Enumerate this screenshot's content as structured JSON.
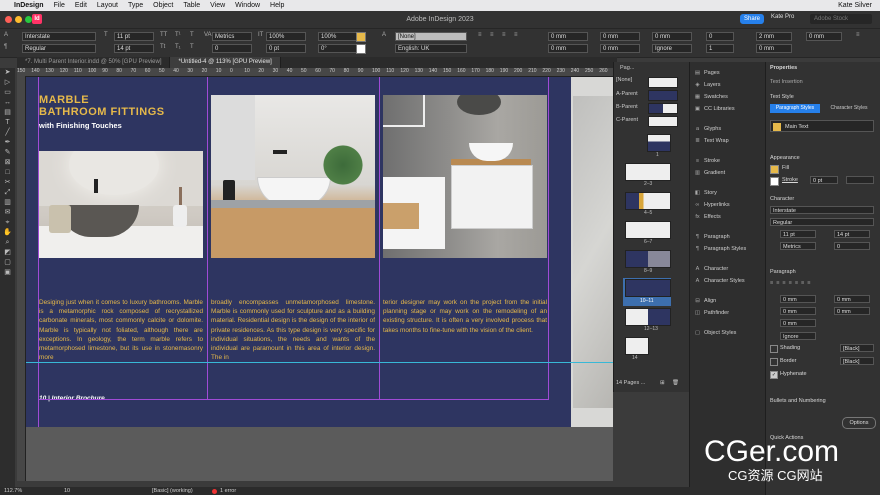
{
  "menubar": {
    "app": "InDesign",
    "items": [
      "File",
      "Edit",
      "Layout",
      "Type",
      "Object",
      "Table",
      "View",
      "Window",
      "Help"
    ],
    "user": "Kate Silver"
  },
  "titlebar": {
    "title": "Adobe InDesign 2023",
    "share": "Share",
    "user": "Kate Pro",
    "search": "Adobe Stock"
  },
  "control": {
    "font": "Interstate",
    "style": "Regular",
    "size": "11 pt",
    "leading": "14 pt",
    "kerning": "Metrics",
    "tracking": "0",
    "hscale": "100%",
    "vscale": "100%",
    "baseline": "0 pt",
    "skew": "0°",
    "charstyle": "[None]",
    "language": "English: UK",
    "indent1": "0 mm",
    "indent2": "0 mm",
    "indent3": "0 mm",
    "indent4": "0 mm",
    "space1": "0 mm",
    "space2": "0 mm",
    "ignore": "Ignore",
    "cols": "1",
    "gutter": "2 mm",
    "gutter2": "0 mm",
    "indent5": "0 mm"
  },
  "tabs": [
    "*7. Multi Parent Interior.indd @ 50% [GPU Preview]",
    "*Untitled-4 @ 113% [GPU Preview]"
  ],
  "ruler": [
    "150",
    "140",
    "130",
    "120",
    "110",
    "100",
    "90",
    "80",
    "70",
    "60",
    "50",
    "40",
    "30",
    "20",
    "10",
    "0",
    "10",
    "20",
    "30",
    "40",
    "50",
    "60",
    "70",
    "80",
    "90",
    "100",
    "110",
    "120",
    "130",
    "140",
    "150",
    "160",
    "170",
    "180",
    "190",
    "200",
    "210",
    "220",
    "230",
    "240",
    "250",
    "260"
  ],
  "document": {
    "heading1": "MARBLE",
    "heading2": "BATHROOM FITTINGS",
    "subheading": "with Finishing Touches",
    "col1": "Desiging just when it comes to luxury bathrooms. Marble is a metamorphic rock composed of recrystallized carbonate minerals, most commonly calcite or dolomite. Marble is typically not foliated, although there are exceptions. In geology, the term marble refers to metamorphosed limestone, but its use in stonemasonry more",
    "col2": "broadly encompasses unmetamorphosed limestone. Marble is commonly used for sculpture and as a building material. Residential design is the design of the interior of private residences. As this type design is very specific for individual situations, the needs and wants of the individual are paramount in this area of interior design. The in",
    "col3": "terior designer may work on the project from the initial planning stage or may work on the remodeling of an existing structure. It is often a very involved process that takes months to fine-tune with the vision of the client.",
    "footer": "10 | Interior Brochure"
  },
  "pages": {
    "title": "Pag...",
    "masters": [
      "[None]",
      "A-Parent",
      "B-Parent",
      "C-Parent"
    ],
    "labels": [
      "1",
      "2–3",
      "4–5",
      "6–7",
      "8–9",
      "10–11",
      "12–13",
      "14"
    ],
    "footer": "14 Pages ..."
  },
  "panels": [
    "Pages",
    "Layers",
    "Swatches",
    "CC Libraries",
    "Glyphs",
    "Text Wrap",
    "Stroke",
    "Gradient",
    "Story",
    "Hyperlinks",
    "Effects",
    "Paragraph",
    "Paragraph Styles",
    "Character",
    "Character Styles",
    "Align",
    "Pathfinder",
    "Object Styles"
  ],
  "properties": {
    "tab": "Properties",
    "textInsertion": "Text Insertion",
    "textStyle": "Text Style",
    "paraStyles": "Paragraph Styles",
    "charStyles": "Character Styles",
    "mainText": "Main Text",
    "appearance": "Appearance",
    "fill": "Fill",
    "stroke": "Stroke",
    "strokeVal": "0 pt",
    "character": "Character",
    "font": "Interstate",
    "style": "Regular",
    "size": "11 pt",
    "leading": "14 pt",
    "kern": "Metrics",
    "track": "0",
    "paragraph": "Paragraph",
    "ind1": "0 mm",
    "ind2": "0 mm",
    "ind3": "0 mm",
    "ind4": "0 mm",
    "ind5": "0 mm",
    "ignore": "Ignore",
    "shading": "Shading",
    "border": "Border",
    "black1": "[Black]",
    "black2": "[Black]",
    "hyphenate": "Hyphenate",
    "bullets": "Bullets and Numbering",
    "options": "Options",
    "quick": "Quick Actions"
  },
  "status": {
    "zoom": "112.7%",
    "page": "10",
    "style": "[Basic] (working)",
    "errors": "1 error"
  },
  "watermark": {
    "main": "CGer.com",
    "sub": "CG资源 CG网站"
  },
  "colors": {
    "page": "#2e3561",
    "gold": "#e6b94a",
    "accent": "#2680eb",
    "frame": "#a04bd6"
  }
}
